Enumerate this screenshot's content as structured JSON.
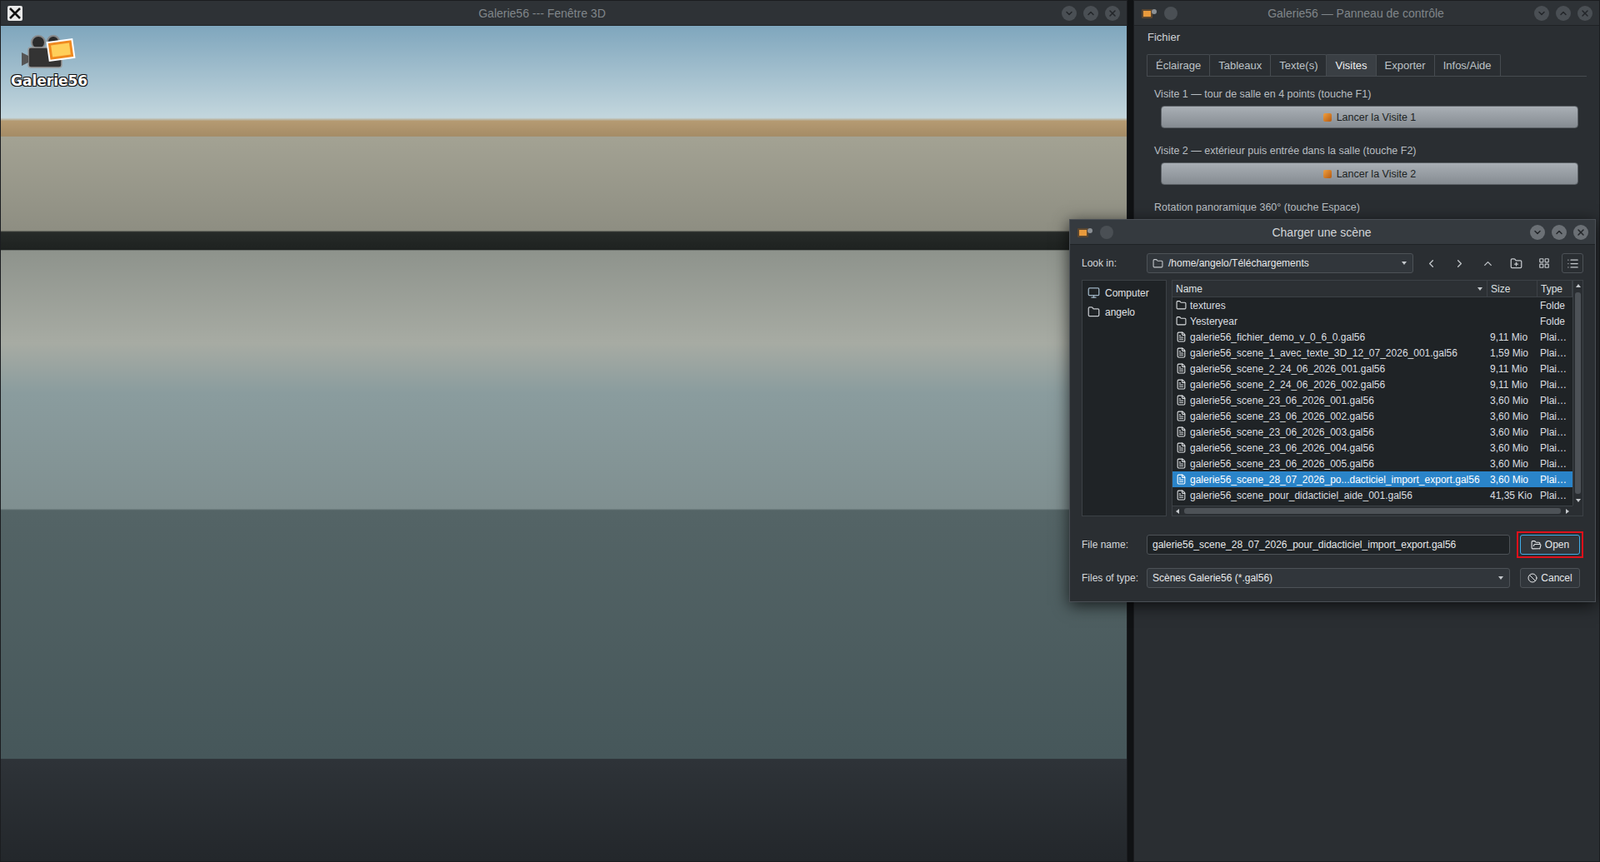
{
  "viewer_window": {
    "title": "Galerie56 --- Fenêtre 3D",
    "logo": "Galerie56"
  },
  "control_panel": {
    "title": "Galerie56 — Panneau de contrôle",
    "menu": [
      "Fichier"
    ],
    "tabs": [
      {
        "label": "Éclairage",
        "selected": false
      },
      {
        "label": "Tableaux",
        "selected": false
      },
      {
        "label": "Texte(s)",
        "selected": false
      },
      {
        "label": "Visites",
        "selected": true
      },
      {
        "label": "Exporter",
        "selected": false
      },
      {
        "label": "Infos/Aide",
        "selected": false
      }
    ],
    "sections": [
      {
        "label": "Visite 1 — tour de salle en 4 points (touche F1)",
        "button": "Lancer la Visite 1"
      },
      {
        "label": "Visite 2 — extérieur puis entrée dans la salle (touche F2)",
        "button": "Lancer la Visite 2"
      },
      {
        "label": "Rotation panoramique 360° (touche Espace)"
      }
    ]
  },
  "dialog": {
    "title": "Charger une scène",
    "look_in_label": "Look in:",
    "path": "/home/angelo/Téléchargements",
    "places": [
      {
        "label": "Computer",
        "kind": "computer",
        "selected": false
      },
      {
        "label": "angelo",
        "kind": "folder",
        "selected": false
      }
    ],
    "columns": [
      "Name",
      "Size",
      "Type"
    ],
    "rows": [
      {
        "name": "textures",
        "type": "Folde",
        "kind": "folder",
        "selected": false
      },
      {
        "name": "Yesteryear",
        "type": "Folde",
        "kind": "folder",
        "selected": false
      },
      {
        "name": "galerie56_fichier_demo_v_0_6_0.gal56",
        "size": "9,11 Mio",
        "type": "Plai…",
        "kind": "file",
        "selected": false
      },
      {
        "name": "galerie56_scene_1_avec_texte_3D_12_07_2026_001.gal56",
        "size": "1,59 Mio",
        "type": "Plai…",
        "kind": "file",
        "selected": false
      },
      {
        "name": "galerie56_scene_2_24_06_2026_001.gal56",
        "size": "9,11 Mio",
        "type": "Plai…",
        "kind": "file",
        "selected": false
      },
      {
        "name": "galerie56_scene_2_24_06_2026_002.gal56",
        "size": "9,11 Mio",
        "type": "Plai…",
        "kind": "file",
        "selected": false
      },
      {
        "name": "galerie56_scene_23_06_2026_001.gal56",
        "size": "3,60 Mio",
        "type": "Plai…",
        "kind": "file",
        "selected": false
      },
      {
        "name": "galerie56_scene_23_06_2026_002.gal56",
        "size": "3,60 Mio",
        "type": "Plai…",
        "kind": "file",
        "selected": false
      },
      {
        "name": "galerie56_scene_23_06_2026_003.gal56",
        "size": "3,60 Mio",
        "type": "Plai…",
        "kind": "file",
        "selected": false
      },
      {
        "name": "galerie56_scene_23_06_2026_004.gal56",
        "size": "3,60 Mio",
        "type": "Plai…",
        "kind": "file",
        "selected": false
      },
      {
        "name": "galerie56_scene_23_06_2026_005.gal56",
        "size": "3,60 Mio",
        "type": "Plai…",
        "kind": "file",
        "selected": false
      },
      {
        "name": "galerie56_scene_28_07_2026_po...dacticiel_import_export.gal56",
        "size": "3,60 Mio",
        "type": "Plai…",
        "kind": "file",
        "selected": true
      },
      {
        "name": "galerie56_scene_pour_didacticiel_aide_001.gal56",
        "size": "41,35 Kio",
        "type": "Plai…",
        "kind": "file",
        "selected": false
      }
    ],
    "file_name_label": "File name:",
    "file_name": "galerie56_scene_28_07_2026_pour_didacticiel_import_export.gal56",
    "type_label": "Files of type:",
    "file_type": "Scènes Galerie56 (*.gal56)",
    "buttons": [
      {
        "label": "Open",
        "kind": "open",
        "highlighted": true
      },
      {
        "label": "Cancel",
        "kind": "cancel",
        "highlighted": false
      }
    ]
  }
}
